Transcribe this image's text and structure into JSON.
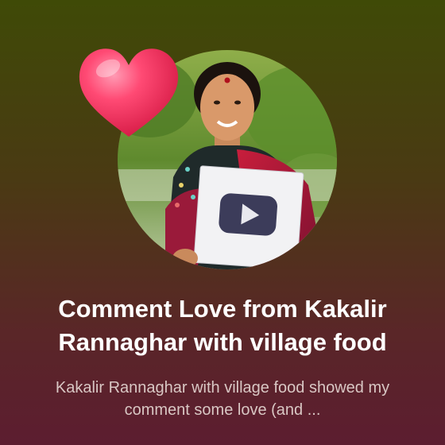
{
  "notification": {
    "title": "Comment Love from Kakalir Rannaghar with village food",
    "body": "Kakalir Rannaghar with village food showed my comment some love (and ..."
  },
  "icons": {
    "reaction": "heart-icon",
    "avatar": "channel-avatar",
    "play_button": "play-icon"
  },
  "colors": {
    "background_top": "#3f4a07",
    "background_bottom": "#5c1d30",
    "heart": "#ff3b6b",
    "title": "#ffffff",
    "subtitle": "#d9c7c4"
  }
}
